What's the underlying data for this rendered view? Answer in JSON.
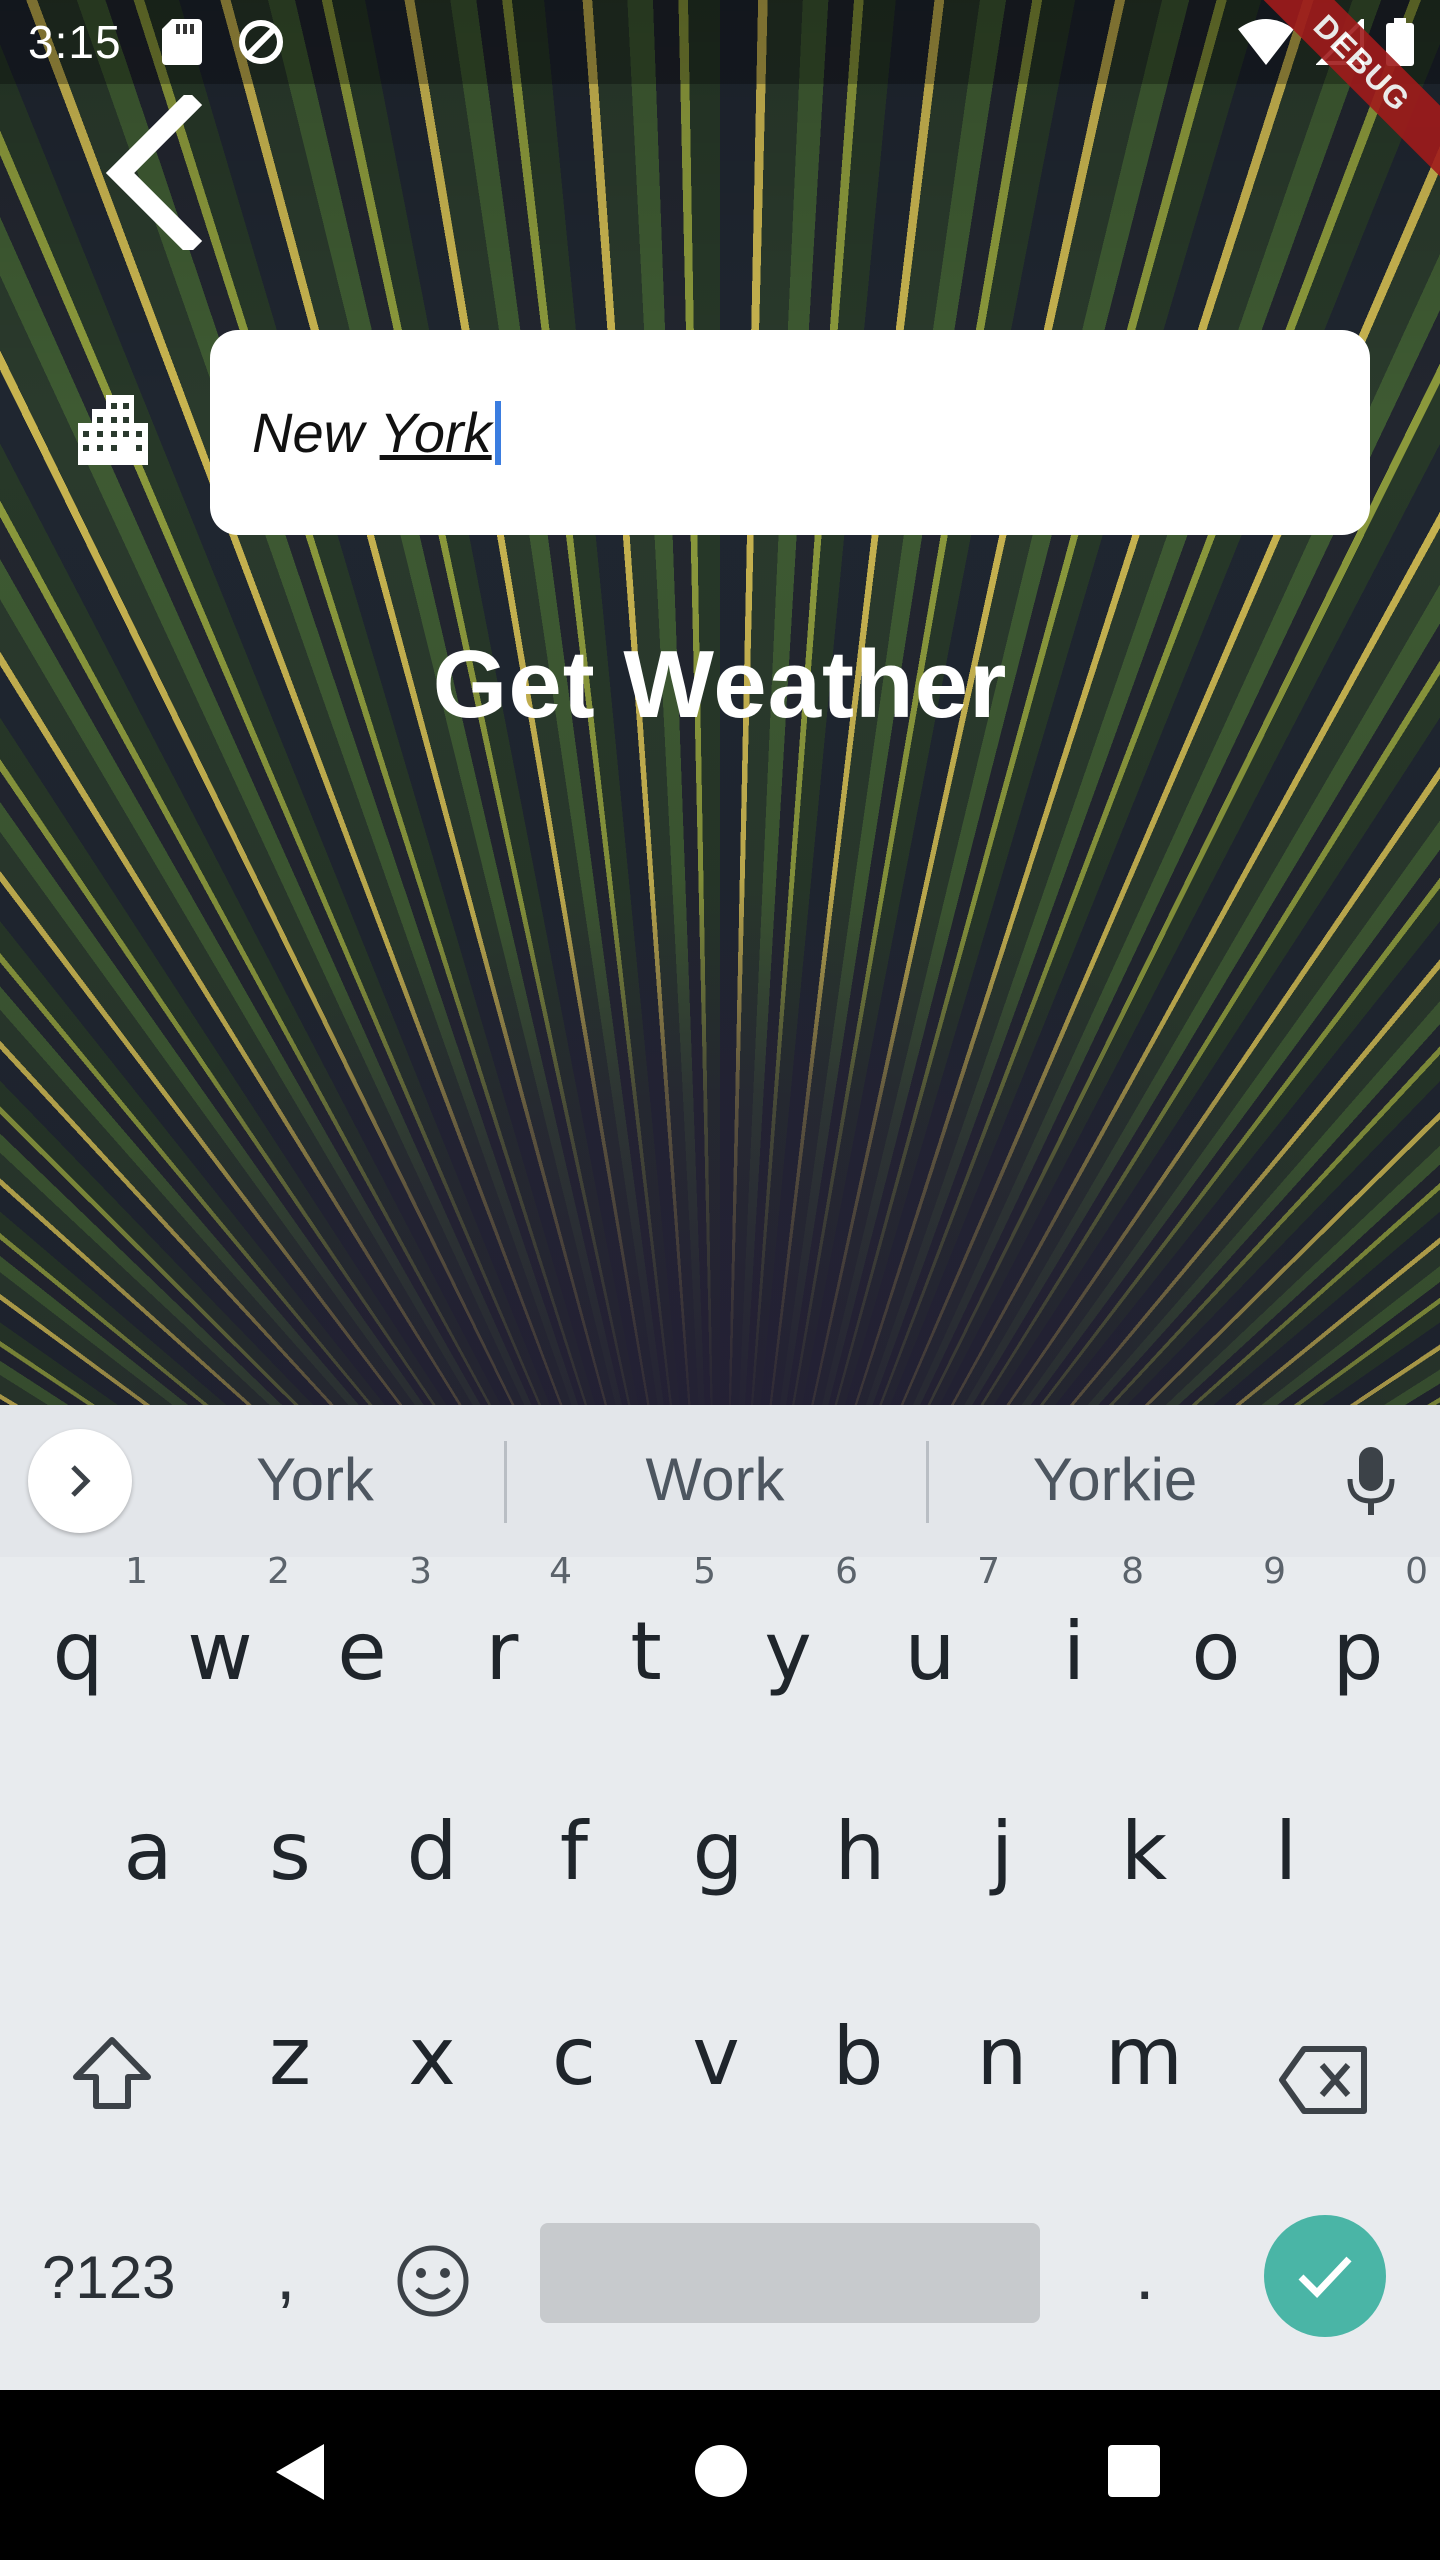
{
  "status_bar": {
    "time": "3:15"
  },
  "debug_banner": "DEBUG",
  "city_input": {
    "value_prefix": "New ",
    "value_underlined": "York"
  },
  "get_weather_label": "Get Weather",
  "keyboard": {
    "suggestions": [
      "York",
      "Work",
      "Yorkie"
    ],
    "row1": [
      {
        "k": "q",
        "h": "1"
      },
      {
        "k": "w",
        "h": "2"
      },
      {
        "k": "e",
        "h": "3"
      },
      {
        "k": "r",
        "h": "4"
      },
      {
        "k": "t",
        "h": "5"
      },
      {
        "k": "y",
        "h": "6"
      },
      {
        "k": "u",
        "h": "7"
      },
      {
        "k": "i",
        "h": "8"
      },
      {
        "k": "o",
        "h": "9"
      },
      {
        "k": "p",
        "h": "0"
      }
    ],
    "row2": [
      "a",
      "s",
      "d",
      "f",
      "g",
      "h",
      "j",
      "k",
      "l"
    ],
    "row3": [
      "z",
      "x",
      "c",
      "v",
      "b",
      "n",
      "m"
    ],
    "symbols_label": "?123",
    "comma": ",",
    "period": "."
  }
}
